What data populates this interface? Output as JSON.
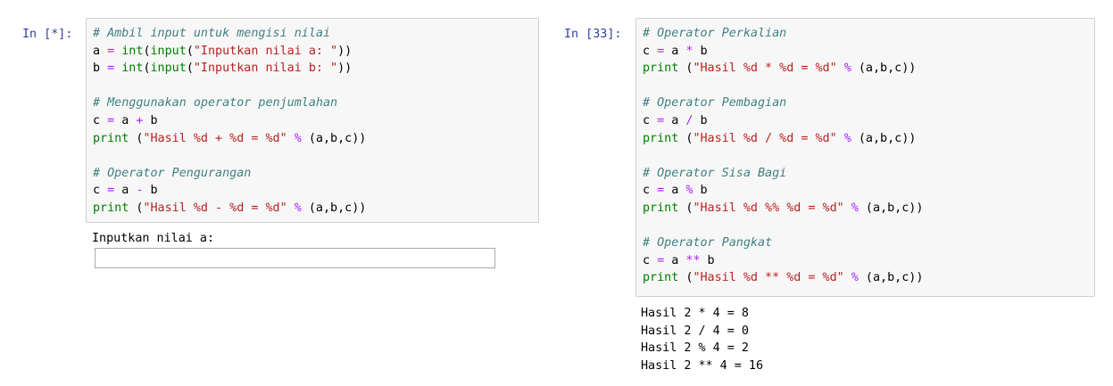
{
  "left_cell": {
    "prompt": "In [*]:",
    "code": [
      [
        {
          "t": "cm",
          "v": "# Ambil input untuk mengisi nilai"
        }
      ],
      [
        {
          "t": "n",
          "v": "a "
        },
        {
          "t": "op",
          "v": "="
        },
        {
          "t": "n",
          "v": " "
        },
        {
          "t": "bi",
          "v": "int"
        },
        {
          "t": "n",
          "v": "("
        },
        {
          "t": "bi",
          "v": "input"
        },
        {
          "t": "n",
          "v": "("
        },
        {
          "t": "str",
          "v": "\"Inputkan nilai a: \""
        },
        {
          "t": "n",
          "v": "))"
        }
      ],
      [
        {
          "t": "n",
          "v": "b "
        },
        {
          "t": "op",
          "v": "="
        },
        {
          "t": "n",
          "v": " "
        },
        {
          "t": "bi",
          "v": "int"
        },
        {
          "t": "n",
          "v": "("
        },
        {
          "t": "bi",
          "v": "input"
        },
        {
          "t": "n",
          "v": "("
        },
        {
          "t": "str",
          "v": "\"Inputkan nilai b: \""
        },
        {
          "t": "n",
          "v": "))"
        }
      ],
      [],
      [
        {
          "t": "cm",
          "v": "# Menggunakan operator penjumlahan"
        }
      ],
      [
        {
          "t": "n",
          "v": "c "
        },
        {
          "t": "op",
          "v": "="
        },
        {
          "t": "n",
          "v": " a "
        },
        {
          "t": "op",
          "v": "+"
        },
        {
          "t": "n",
          "v": " b"
        }
      ],
      [
        {
          "t": "bi",
          "v": "print"
        },
        {
          "t": "n",
          "v": " ("
        },
        {
          "t": "str",
          "v": "\"Hasil %d + %d = %d\""
        },
        {
          "t": "n",
          "v": " "
        },
        {
          "t": "op",
          "v": "%"
        },
        {
          "t": "n",
          "v": " (a,b,c))"
        }
      ],
      [],
      [
        {
          "t": "cm",
          "v": "# Operator Pengurangan"
        }
      ],
      [
        {
          "t": "n",
          "v": "c "
        },
        {
          "t": "op",
          "v": "="
        },
        {
          "t": "n",
          "v": " a "
        },
        {
          "t": "op",
          "v": "-"
        },
        {
          "t": "n",
          "v": " b"
        }
      ],
      [
        {
          "t": "bi",
          "v": "print"
        },
        {
          "t": "n",
          "v": " ("
        },
        {
          "t": "str",
          "v": "\"Hasil %d - %d = %d\""
        },
        {
          "t": "n",
          "v": " "
        },
        {
          "t": "op",
          "v": "%"
        },
        {
          "t": "n",
          "v": " (a,b,c))"
        }
      ]
    ],
    "stdin_prompt": "Inputkan nilai a:",
    "stdin_value": ""
  },
  "right_cell": {
    "prompt": "In [33]:",
    "code": [
      [
        {
          "t": "cm",
          "v": "# Operator Perkalian"
        }
      ],
      [
        {
          "t": "n",
          "v": "c "
        },
        {
          "t": "op",
          "v": "="
        },
        {
          "t": "n",
          "v": " a "
        },
        {
          "t": "op",
          "v": "*"
        },
        {
          "t": "n",
          "v": " b"
        }
      ],
      [
        {
          "t": "bi",
          "v": "print"
        },
        {
          "t": "n",
          "v": " ("
        },
        {
          "t": "str",
          "v": "\"Hasil %d * %d = %d\""
        },
        {
          "t": "n",
          "v": " "
        },
        {
          "t": "op",
          "v": "%"
        },
        {
          "t": "n",
          "v": " (a,b,c))"
        }
      ],
      [],
      [
        {
          "t": "cm",
          "v": "# Operator Pembagian"
        }
      ],
      [
        {
          "t": "n",
          "v": "c "
        },
        {
          "t": "op",
          "v": "="
        },
        {
          "t": "n",
          "v": " a "
        },
        {
          "t": "op",
          "v": "/"
        },
        {
          "t": "n",
          "v": " b"
        }
      ],
      [
        {
          "t": "bi",
          "v": "print"
        },
        {
          "t": "n",
          "v": " ("
        },
        {
          "t": "str",
          "v": "\"Hasil %d / %d = %d\""
        },
        {
          "t": "n",
          "v": " "
        },
        {
          "t": "op",
          "v": "%"
        },
        {
          "t": "n",
          "v": " (a,b,c))"
        }
      ],
      [],
      [
        {
          "t": "cm",
          "v": "# Operator Sisa Bagi"
        }
      ],
      [
        {
          "t": "n",
          "v": "c "
        },
        {
          "t": "op",
          "v": "="
        },
        {
          "t": "n",
          "v": " a "
        },
        {
          "t": "op",
          "v": "%"
        },
        {
          "t": "n",
          "v": " b"
        }
      ],
      [
        {
          "t": "bi",
          "v": "print"
        },
        {
          "t": "n",
          "v": " ("
        },
        {
          "t": "str",
          "v": "\"Hasil %d %% %d = %d\""
        },
        {
          "t": "n",
          "v": " "
        },
        {
          "t": "op",
          "v": "%"
        },
        {
          "t": "n",
          "v": " (a,b,c))"
        }
      ],
      [],
      [
        {
          "t": "cm",
          "v": "# Operator Pangkat"
        }
      ],
      [
        {
          "t": "n",
          "v": "c "
        },
        {
          "t": "op",
          "v": "="
        },
        {
          "t": "n",
          "v": " a "
        },
        {
          "t": "op",
          "v": "**"
        },
        {
          "t": "n",
          "v": " b"
        }
      ],
      [
        {
          "t": "bi",
          "v": "print"
        },
        {
          "t": "n",
          "v": " ("
        },
        {
          "t": "str",
          "v": "\"Hasil %d ** %d = %d\""
        },
        {
          "t": "n",
          "v": " "
        },
        {
          "t": "op",
          "v": "%"
        },
        {
          "t": "n",
          "v": " (a,b,c))"
        }
      ]
    ],
    "output": [
      "Hasil 2 * 4 = 8",
      "Hasil 2 / 4 = 0",
      "Hasil 2 % 4 = 2",
      "Hasil 2 ** 4 = 16"
    ]
  },
  "colors": {
    "prompt": "#303f9f",
    "comment": "#408080",
    "operator": "#aa22ff",
    "string": "#ba2121",
    "builtin": "#008000",
    "cell_background": "#f7f7f7",
    "cell_border": "#cfcfcf"
  }
}
